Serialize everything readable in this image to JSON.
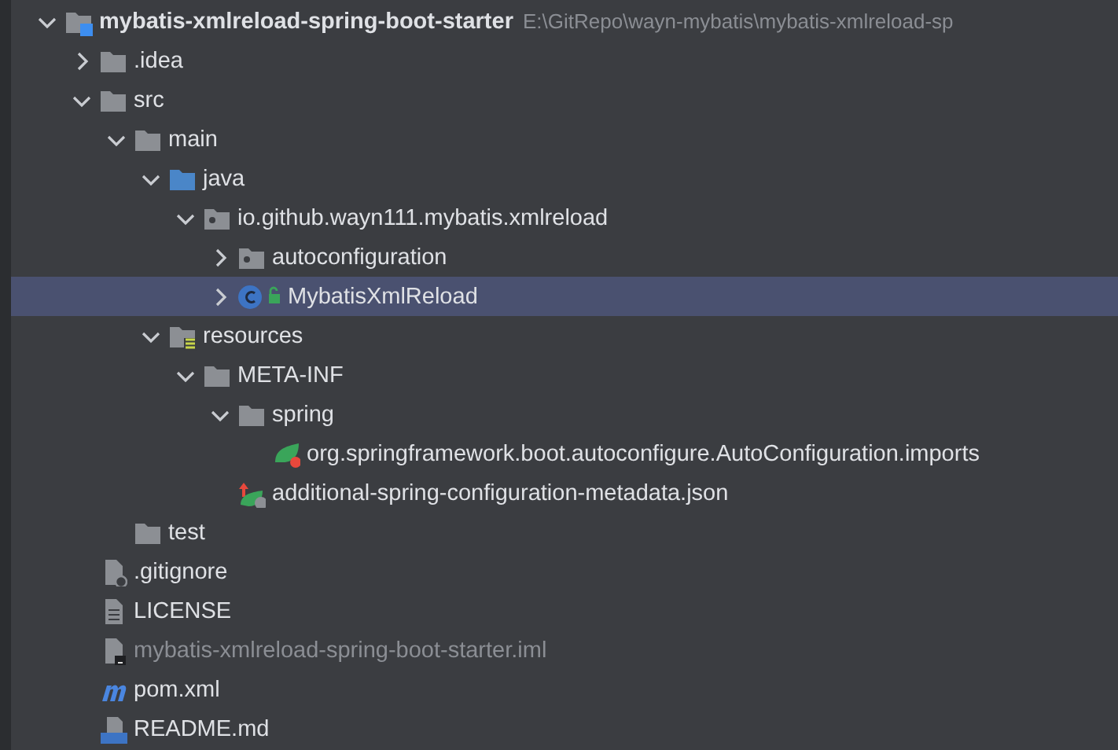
{
  "tree": [
    {
      "label": "mybatis-xmlreload-spring-boot-starter",
      "path": "E:\\GitRepo\\wayn-mybatis\\mybatis-xmlreload-sp",
      "kind": "module",
      "expanded": true,
      "selected": false,
      "dimmed": false,
      "children": [
        {
          "label": ".idea",
          "kind": "folder",
          "expanded": false,
          "selected": false,
          "dimmed": false
        },
        {
          "label": "src",
          "kind": "folder",
          "expanded": true,
          "selected": false,
          "dimmed": false,
          "children": [
            {
              "label": "main",
              "kind": "folder",
              "expanded": true,
              "selected": false,
              "dimmed": false,
              "children": [
                {
                  "label": "java",
                  "kind": "source-folder",
                  "expanded": true,
                  "selected": false,
                  "dimmed": false,
                  "children": [
                    {
                      "label": "io.github.wayn111.mybatis.xmlreload",
                      "kind": "package",
                      "expanded": true,
                      "selected": false,
                      "dimmed": false,
                      "children": [
                        {
                          "label": "autoconfiguration",
                          "kind": "package",
                          "expanded": false,
                          "selected": false,
                          "dimmed": false
                        },
                        {
                          "label": "MybatisXmlReload",
                          "kind": "class",
                          "expanded": false,
                          "selected": true,
                          "dimmed": false
                        }
                      ]
                    }
                  ]
                },
                {
                  "label": "resources",
                  "kind": "resources",
                  "expanded": true,
                  "selected": false,
                  "dimmed": false,
                  "children": [
                    {
                      "label": "META-INF",
                      "kind": "folder",
                      "expanded": true,
                      "selected": false,
                      "dimmed": false,
                      "children": [
                        {
                          "label": "spring",
                          "kind": "folder",
                          "expanded": true,
                          "selected": false,
                          "dimmed": false,
                          "children": [
                            {
                              "label": "org.springframework.boot.autoconfigure.AutoConfiguration.imports",
                              "kind": "spring-file",
                              "selected": false,
                              "dimmed": false
                            }
                          ]
                        },
                        {
                          "label": "additional-spring-configuration-metadata.json",
                          "kind": "spring-json",
                          "selected": false,
                          "dimmed": false
                        }
                      ]
                    }
                  ]
                }
              ]
            },
            {
              "label": "test",
              "kind": "folder",
              "selected": false,
              "dimmed": false
            }
          ]
        },
        {
          "label": ".gitignore",
          "kind": "gitignore",
          "selected": false,
          "dimmed": false
        },
        {
          "label": "LICENSE",
          "kind": "text-file",
          "selected": false,
          "dimmed": false
        },
        {
          "label": "mybatis-xmlreload-spring-boot-starter.iml",
          "kind": "iml",
          "selected": false,
          "dimmed": true
        },
        {
          "label": "pom.xml",
          "kind": "maven",
          "selected": false,
          "dimmed": false
        },
        {
          "label": "README.md",
          "kind": "markdown",
          "selected": false,
          "dimmed": false
        }
      ]
    }
  ]
}
